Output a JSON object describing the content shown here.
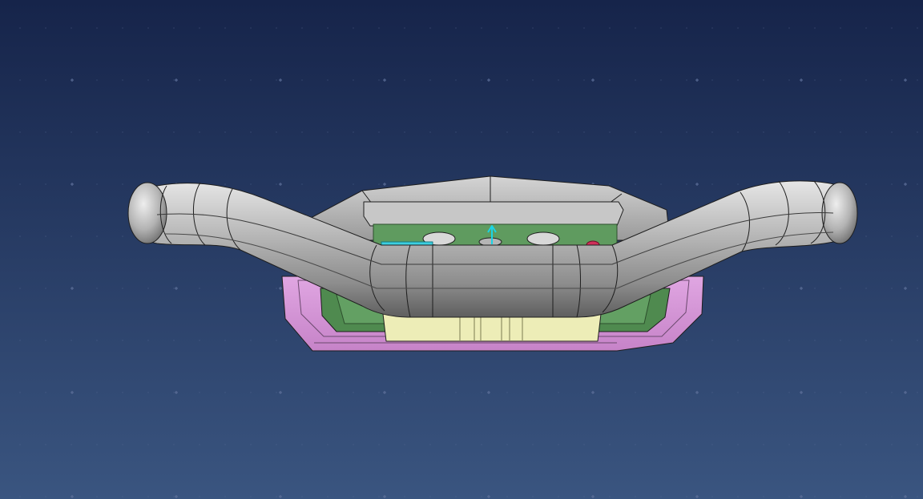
{
  "viewport": {
    "background_top": "#16244a",
    "background_bottom": "#3a5580",
    "grid_mark_color": "#5d6f99",
    "show_grid_marks": true
  },
  "model": {
    "handle_color": "#9c9c9c",
    "handle_highlight": "#e6e6e6",
    "body_color": "#a9a9a9",
    "body_top_color": "#bdbdbd",
    "plate_color": "#d79ad9",
    "inner_pocket_color": "#4f8a4f",
    "insert_color": "#ededb7",
    "accent_cyan": "#3ccfe0",
    "accent_red": "#d0305a",
    "edge_color": "#1e1e1e",
    "axis_marker_color": "#1ad4e6"
  }
}
